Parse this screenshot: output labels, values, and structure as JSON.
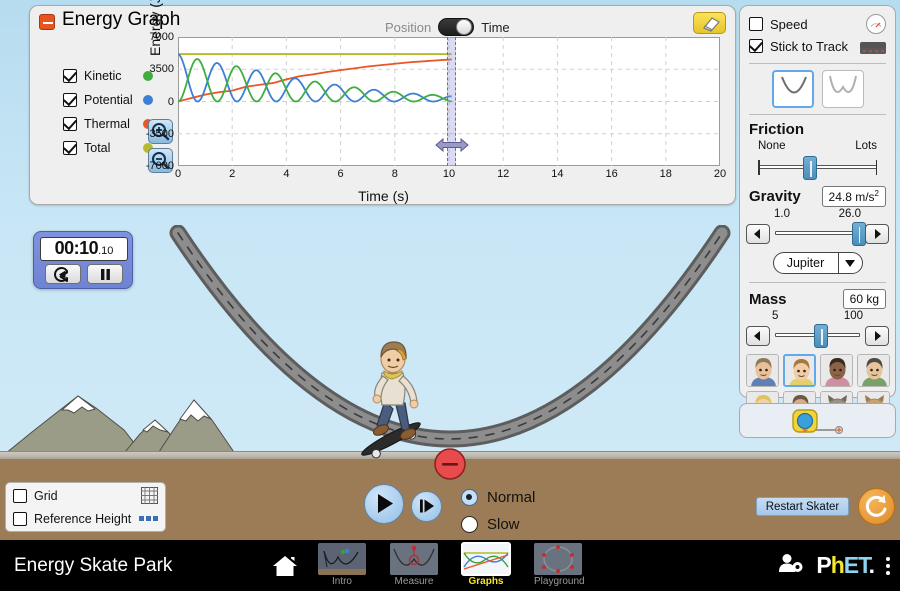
{
  "app": {
    "title": "Energy Skate Park",
    "nav_tabs": [
      {
        "label": "Intro",
        "active": false
      },
      {
        "label": "Measure",
        "active": false
      },
      {
        "label": "Graphs",
        "active": true
      },
      {
        "label": "Playground",
        "active": false
      }
    ],
    "home_icon": "home-icon",
    "account_icon": "account-gear-icon",
    "logo_text": "PhET",
    "kebab_icon": "kebab-menu-icon"
  },
  "graph_panel": {
    "title": "Energy Graph",
    "collapse_icon": "minus-icon",
    "eraser_icon": "eraser-icon",
    "toggle": {
      "left_label": "Position",
      "right_label": "Time",
      "selected": "Time"
    },
    "legend": [
      {
        "label": "Kinetic",
        "color": "#3fae3f",
        "checked": true
      },
      {
        "label": "Potential",
        "color": "#3d7fd6",
        "checked": true
      },
      {
        "label": "Thermal",
        "color": "#e8562a",
        "checked": true
      },
      {
        "label": "Total",
        "color": "#b9b92e",
        "checked": true
      }
    ],
    "zoom_in_icon": "zoom-in-icon",
    "zoom_out_icon": "zoom-out-icon",
    "cursor_time": "10.1"
  },
  "chart_data": {
    "type": "line",
    "title": "Energy Graph",
    "xlabel": "Time (s)",
    "ylabel": "Energy (J)",
    "xlim": [
      0,
      20
    ],
    "ylim": [
      -7000,
      7000
    ],
    "xticks": [
      0,
      2,
      4,
      6,
      8,
      10,
      12,
      14,
      16,
      18,
      20
    ],
    "yticks": [
      7000,
      3500,
      0,
      -3500,
      -7000
    ],
    "grid": true,
    "legend_position": "left",
    "data_end_time": 10.1,
    "series": [
      {
        "name": "Total",
        "color": "#b9b92e",
        "x": [
          0,
          1,
          2,
          3,
          4,
          5,
          6,
          7,
          8,
          9,
          10,
          10.1
        ],
        "y": [
          5150,
          5150,
          5150,
          5150,
          5150,
          5150,
          5150,
          5150,
          5150,
          5150,
          5150,
          5150
        ]
      },
      {
        "name": "Thermal",
        "color": "#e8562a",
        "x": [
          0,
          0.5,
          1,
          1.5,
          2,
          2.5,
          3,
          3.5,
          4,
          4.5,
          5,
          5.5,
          6,
          6.5,
          7,
          7.5,
          8,
          8.5,
          9,
          9.5,
          10,
          10.1
        ],
        "y": [
          0,
          380,
          750,
          1000,
          1180,
          1600,
          1800,
          2000,
          2400,
          2750,
          2950,
          3200,
          3400,
          3600,
          3800,
          3950,
          4100,
          4250,
          4350,
          4450,
          4550,
          4580
        ]
      },
      {
        "name": "Potential",
        "color": "#3d7fd6",
        "note": "Oscillating, decaying from 5150 to near 0, period about 1.45 s, starts at maximum",
        "start": 5150,
        "period": 1.45,
        "decay_to": 300
      },
      {
        "name": "Kinetic",
        "color": "#3fae3f",
        "note": "Oscillating out of phase with Potential, decaying; Kinetic + Potential + Thermal = Total",
        "start": 0,
        "period": 1.45,
        "decay_to": 300
      }
    ]
  },
  "stopwatch": {
    "time_main": "00:10",
    "time_frac": ".10",
    "reset_icon": "reset-arrow-icon",
    "pause_icon": "pause-icon"
  },
  "controls": {
    "speed_checkbox": {
      "label": "Speed",
      "checked": false,
      "icon": "speedometer-icon"
    },
    "stick_checkbox": {
      "label": "Stick to Track",
      "checked": true,
      "icon": "dashed-track-icon"
    },
    "track_shapes": [
      {
        "name": "u-shape-track",
        "selected": true
      },
      {
        "name": "w-shape-track",
        "selected": false
      }
    ],
    "friction": {
      "title": "Friction",
      "min_label": "None",
      "max_label": "Lots",
      "thumb_percent": 41
    },
    "gravity": {
      "title": "Gravity",
      "value": "24.8 m/s",
      "exponent": "2",
      "min_label": "1.0",
      "max_label": "26.0",
      "thumb_percent": 95,
      "left_arrow_icon": "left-arrow-icon",
      "right_arrow_icon": "right-arrow-icon",
      "planet": "Jupiter",
      "dropdown_icon": "chevron-down-icon"
    },
    "mass": {
      "title": "Mass",
      "value": "60 kg",
      "min_label": "5",
      "max_label": "100",
      "thumb_percent": 50,
      "left_arrow_icon": "left-arrow-icon",
      "right_arrow_icon": "right-arrow-icon"
    },
    "characters": [
      {
        "name": "character-1",
        "selected": false,
        "skin": "#e8c19a",
        "hair": "#8f7a5b",
        "shirt": "#5f7fb5"
      },
      {
        "name": "character-2",
        "selected": true,
        "skin": "#f0cda4",
        "hair": "#a8763f",
        "shirt": "#e4cf6a"
      },
      {
        "name": "character-3",
        "selected": false,
        "skin": "#8a6448",
        "hair": "#3c2a1e",
        "shirt": "#cf8fa0"
      },
      {
        "name": "character-4",
        "selected": false,
        "skin": "#e8c49c",
        "hair": "#4f4a44",
        "shirt": "#7aa06a"
      },
      {
        "name": "character-5",
        "selected": false,
        "skin": "#f1d3ab",
        "hair": "#ddc463",
        "shirt": "#f2e05a"
      },
      {
        "name": "character-6",
        "selected": false,
        "skin": "#d8ae84",
        "hair": "#6d5946",
        "shirt": "#9a8fc4"
      },
      {
        "name": "character-cat",
        "selected": false,
        "skin": "#9a9287",
        "hair": "#6f685e",
        "shirt": "#8c8478"
      },
      {
        "name": "character-dog",
        "selected": false,
        "skin": "#c9a173",
        "hair": "#9c7a50",
        "shirt": "#c9a173"
      }
    ],
    "measuring_tape": {
      "name": "measuring-tape",
      "icon": "measuring-tape-icon"
    }
  },
  "scene": {
    "grid_checkbox": {
      "label": "Grid",
      "checked": false,
      "icon": "grid-icon"
    },
    "ref_height_checkbox": {
      "label": "Reference Height",
      "checked": false,
      "icon": "dotted-line-icon"
    },
    "play_icon": "play-icon",
    "step_icon": "step-forward-icon",
    "speed_options": [
      {
        "label": "Normal",
        "selected": true
      },
      {
        "label": "Slow",
        "selected": false
      }
    ],
    "restart_label": "Restart Skater",
    "reset_all_icon": "reset-all-icon"
  }
}
